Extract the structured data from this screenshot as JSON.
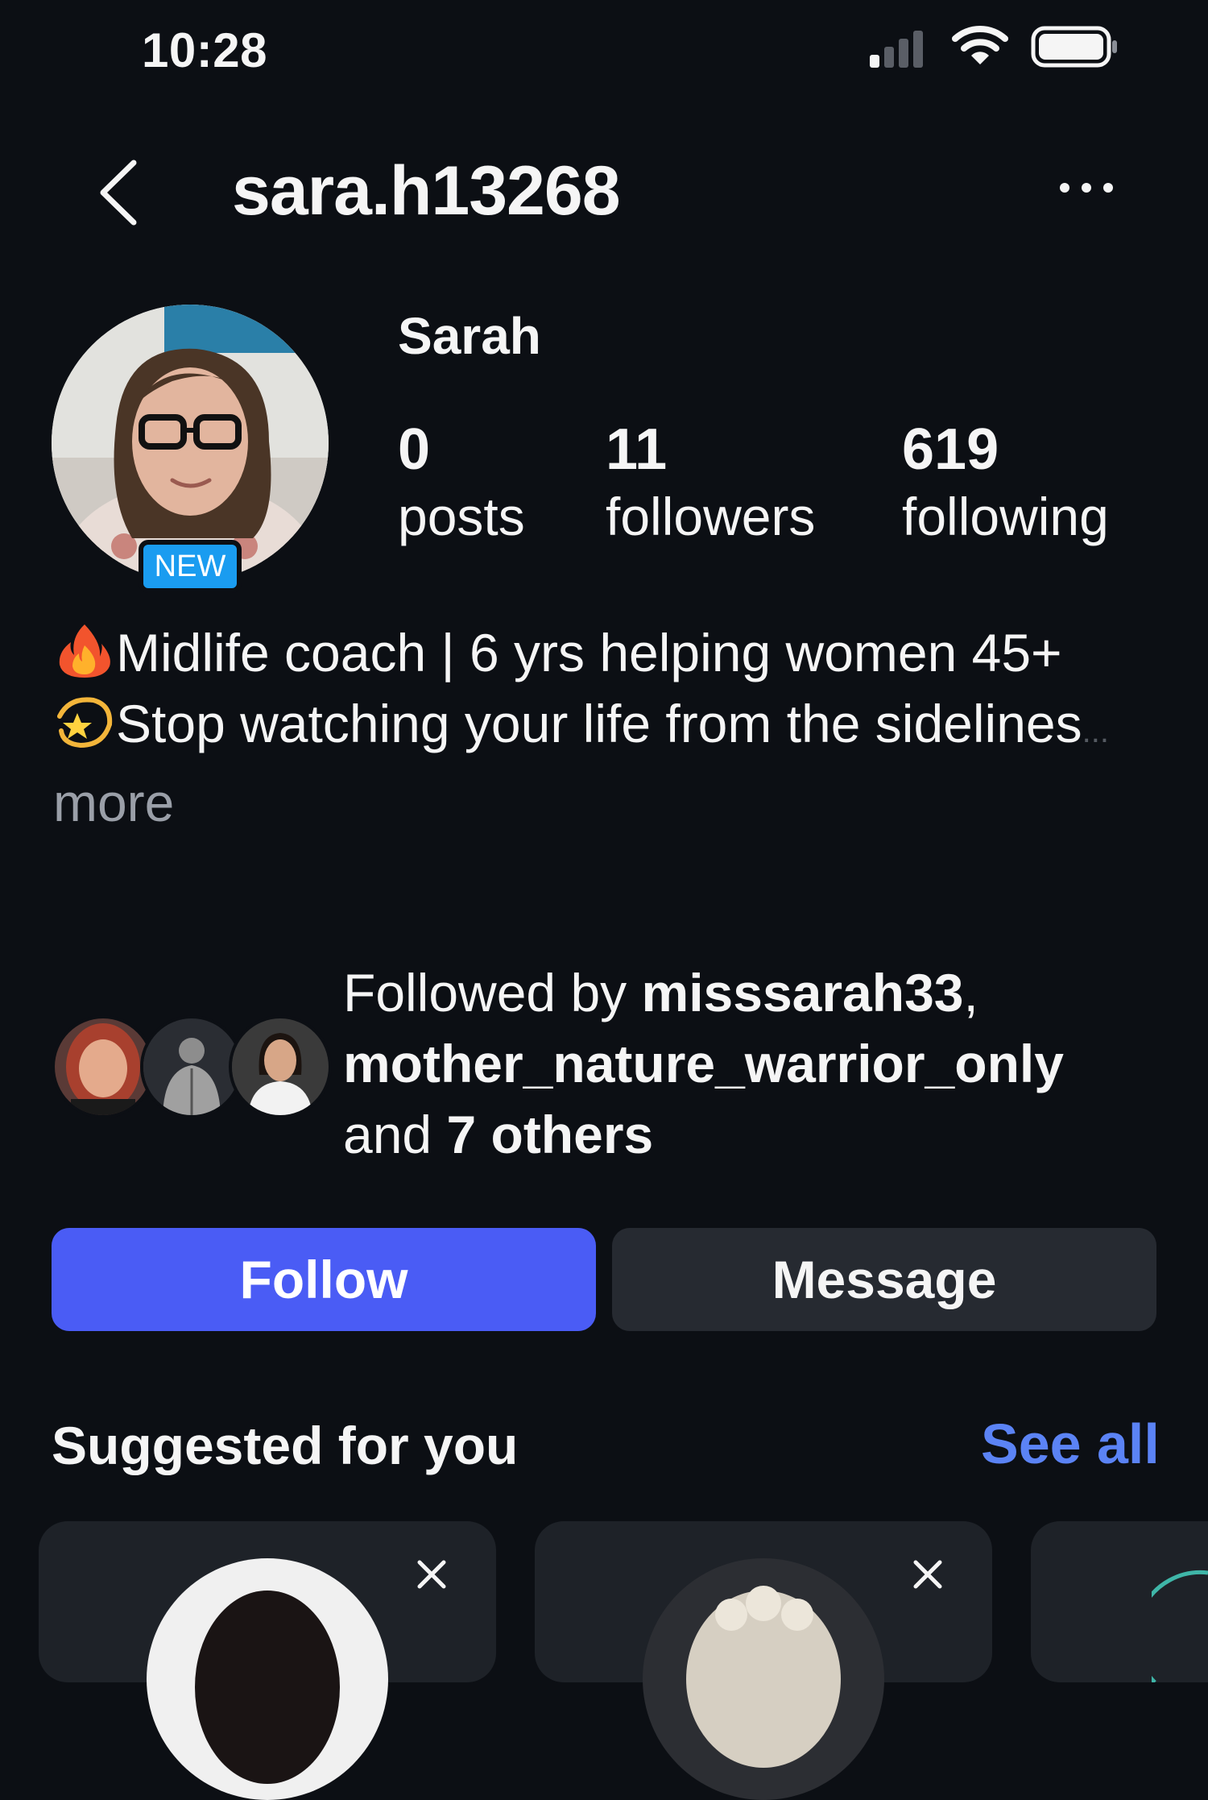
{
  "status_bar": {
    "time": "10:28",
    "signal_icon": "cellular-signal-icon",
    "wifi_icon": "wifi-icon",
    "battery_icon": "battery-icon"
  },
  "header": {
    "username": "sara.h13268",
    "back_icon": "chevron-left-icon",
    "more_icon": "more-horizontal-icon"
  },
  "profile": {
    "display_name": "Sarah",
    "new_badge": "NEW",
    "stats": [
      {
        "value": "0",
        "label": "posts"
      },
      {
        "value": "11",
        "label": "followers"
      },
      {
        "value": "619",
        "label": "following"
      }
    ]
  },
  "bio": {
    "line1": "Midlife coach | 6 yrs helping women 45+",
    "line2": "Stop watching your life from the sidelines",
    "ellipsis": "...",
    "more": "more",
    "emoji1": "fire-emoji",
    "emoji2": "dizzy-star-emoji"
  },
  "followed_by": {
    "prefix": "Followed by ",
    "user1": "misssarah33",
    "separator": ",",
    "user2": "mother_nature_warrior_only",
    "and_text": "and ",
    "others": "7 others"
  },
  "actions": {
    "follow": "Follow",
    "message": "Message"
  },
  "suggested": {
    "title": "Suggested for you",
    "see_all": "See all"
  },
  "colors": {
    "background": "#0c0f14",
    "follow_button": "#4a5cf5",
    "message_button": "#262a31",
    "see_all": "#5b83f5",
    "new_badge": "#1a9cf0"
  }
}
